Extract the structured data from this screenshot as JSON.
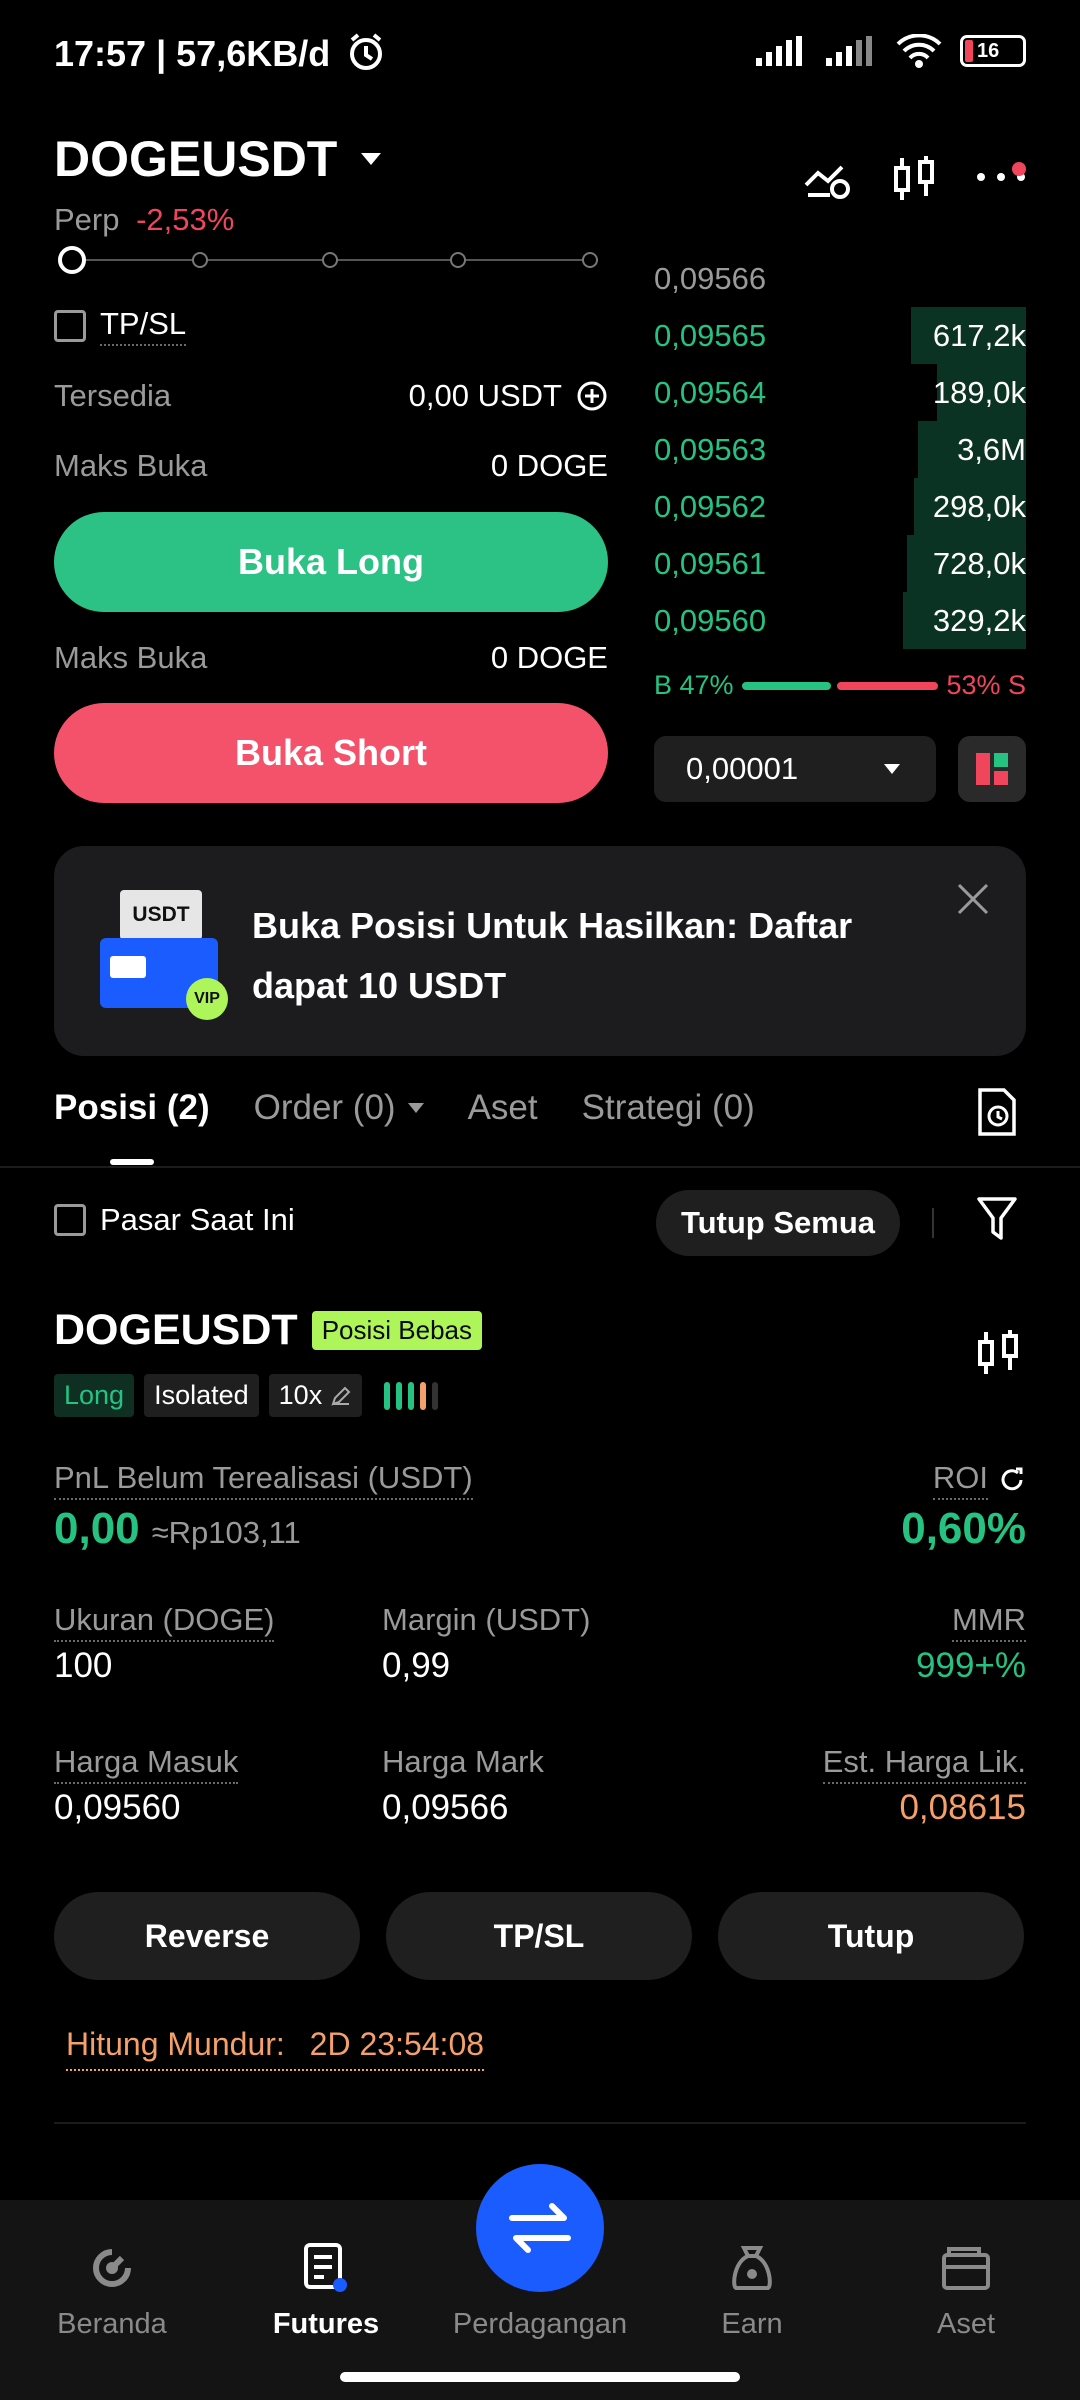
{
  "status_bar": {
    "time": "17:57 | 57,6KB/d",
    "battery": "16"
  },
  "header": {
    "pair": "DOGEUSDT",
    "type": "Perp",
    "change": "-2,53%"
  },
  "order_form": {
    "tpsl_label": "TP/SL",
    "available_label": "Tersedia",
    "available_value": "0,00 USDT",
    "max_open_label": "Maks Buka",
    "max_open_long": "0 DOGE",
    "max_open_short": "0 DOGE",
    "long_button": "Buka Long",
    "short_button": "Buka Short"
  },
  "order_book": {
    "last_price": "0,09566",
    "bids": [
      {
        "price": "0,09565",
        "size": "617,2k",
        "depth": 0.31
      },
      {
        "price": "0,09564",
        "size": "189,0k",
        "depth": 0.24
      },
      {
        "price": "0,09563",
        "size": "3,6M",
        "depth": 0.29
      },
      {
        "price": "0,09562",
        "size": "298,0k",
        "depth": 0.3
      },
      {
        "price": "0,09561",
        "size": "728,0k",
        "depth": 0.32
      },
      {
        "price": "0,09560",
        "size": "329,2k",
        "depth": 0.33
      }
    ],
    "buy_ratio": "B 47%",
    "sell_ratio": "53% S",
    "buy_fraction": 0.47,
    "precision": "0,00001"
  },
  "banner": {
    "badge_top": "USDT",
    "badge_vip": "VIP",
    "text": "Buka Posisi Untuk Hasilkan: Daftar dapat 10 USDT"
  },
  "tabs": [
    {
      "label": "Posisi (2)"
    },
    {
      "label": "Order (0)"
    },
    {
      "label": "Aset"
    },
    {
      "label": "Strategi (0)"
    }
  ],
  "filters": {
    "current_market": "Pasar Saat Ini",
    "close_all": "Tutup Semua"
  },
  "position": {
    "symbol": "DOGEUSDT",
    "mode_badge": "Posisi Bebas",
    "side": "Long",
    "margin_mode": "Isolated",
    "leverage": "10x",
    "pnl_label": "PnL Belum Terealisasi (USDT)",
    "pnl_value": "0,00",
    "pnl_idr": "≈Rp103,11",
    "roi_label": "ROI",
    "roi_value": "0,60%",
    "size_label": "Ukuran (DOGE)",
    "size_value": "100",
    "margin_label": "Margin (USDT)",
    "margin_value": "0,99",
    "mmr_label": "MMR",
    "mmr_value": "999+%",
    "entry_label": "Harga Masuk",
    "entry_value": "0,09560",
    "mark_label": "Harga Mark",
    "mark_value": "0,09566",
    "liq_label": "Est. Harga Lik.",
    "liq_value": "0,08615",
    "reverse": "Reverse",
    "tpsl": "TP/SL",
    "close": "Tutup",
    "countdown_label": "Hitung Mundur:",
    "countdown_value": "2D 23:54:08"
  },
  "nav": [
    {
      "label": "Beranda",
      "icon": "home-icon"
    },
    {
      "label": "Futures",
      "icon": "futures-icon"
    },
    {
      "label": "Perdagangan",
      "icon": "trade-icon"
    },
    {
      "label": "Earn",
      "icon": "earn-icon"
    },
    {
      "label": "Aset",
      "icon": "wallet-icon"
    }
  ],
  "colors": {
    "green": "#26c281",
    "red": "#f0455b",
    "blue": "#1a5cff",
    "lime": "#aef55a",
    "orange": "#f5a06a"
  }
}
